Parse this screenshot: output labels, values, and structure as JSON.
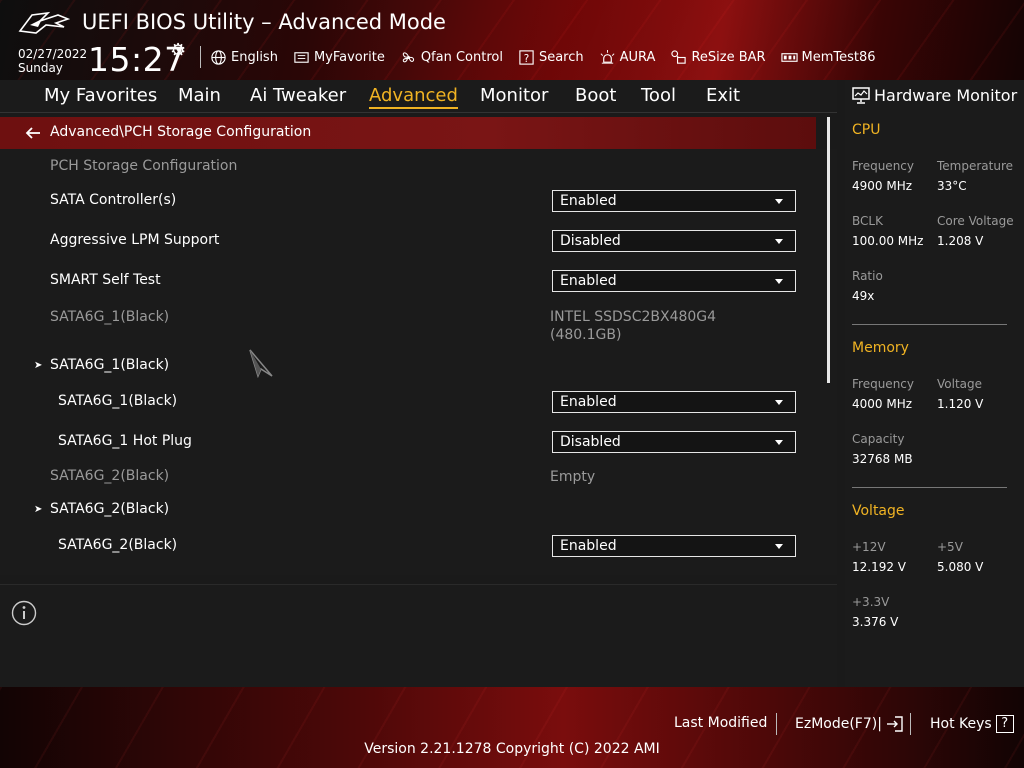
{
  "header": {
    "title": "UEFI BIOS Utility – Advanced Mode",
    "date": "02/27/2022",
    "day": "Sunday",
    "time": "15:27",
    "tools": [
      {
        "label": "English",
        "icon": "globe-icon"
      },
      {
        "label": "MyFavorite",
        "icon": "favorite-list-icon"
      },
      {
        "label": "Qfan Control",
        "icon": "fan-icon"
      },
      {
        "label": "Search",
        "icon": "search-help-icon"
      },
      {
        "label": "AURA",
        "icon": "aura-light-icon"
      },
      {
        "label": "ReSize BAR",
        "icon": "resize-bar-icon"
      },
      {
        "label": "MemTest86",
        "icon": "memtest-icon"
      }
    ]
  },
  "nav": {
    "tabs": [
      "My Favorites",
      "Main",
      "Ai Tweaker",
      "Advanced",
      "Monitor",
      "Boot",
      "Tool",
      "Exit"
    ],
    "active": "Advanced"
  },
  "breadcrumb": "Advanced\\PCH Storage Configuration",
  "settings": {
    "section_title": "PCH Storage Configuration",
    "sata_controller": {
      "label": "SATA Controller(s)",
      "value": "Enabled"
    },
    "aggressive_lpm": {
      "label": "Aggressive LPM Support",
      "value": "Disabled"
    },
    "smart_self_test": {
      "label": "SMART Self Test",
      "value": "Enabled"
    },
    "port1_info": {
      "label": "SATA6G_1(Black)",
      "value_line1": "INTEL SSDSC2BX480G4",
      "value_line2": "(480.1GB)"
    },
    "port1_group": {
      "label": "SATA6G_1(Black)"
    },
    "port1_enable": {
      "label": "SATA6G_1(Black)",
      "value": "Enabled"
    },
    "port1_hotplug": {
      "label": "SATA6G_1 Hot Plug",
      "value": "Disabled"
    },
    "port2_info": {
      "label": "SATA6G_2(Black)",
      "value": "Empty"
    },
    "port2_group": {
      "label": "SATA6G_2(Black)"
    },
    "port2_enable": {
      "label": "SATA6G_2(Black)",
      "value": "Enabled"
    }
  },
  "hardware_monitor": {
    "title": "Hardware Monitor",
    "cpu": {
      "title": "CPU",
      "frequency_label": "Frequency",
      "frequency": "4900 MHz",
      "temperature_label": "Temperature",
      "temperature": "33°C",
      "bclk_label": "BCLK",
      "bclk": "100.00 MHz",
      "core_voltage_label": "Core Voltage",
      "core_voltage": "1.208 V",
      "ratio_label": "Ratio",
      "ratio": "49x"
    },
    "memory": {
      "title": "Memory",
      "frequency_label": "Frequency",
      "frequency": "4000 MHz",
      "voltage_label": "Voltage",
      "voltage": "1.120 V",
      "capacity_label": "Capacity",
      "capacity": "32768 MB"
    },
    "voltage": {
      "title": "Voltage",
      "v12_label": "+12V",
      "v12": "12.192 V",
      "v5_label": "+5V",
      "v5": "5.080 V",
      "v33_label": "+3.3V",
      "v33": "3.376 V"
    }
  },
  "footer": {
    "last_modified": "Last Modified",
    "ezmode": "EzMode(F7)|",
    "hot_keys": "Hot Keys",
    "hot_keys_key": "?",
    "version": "Version 2.21.1278 Copyright (C) 2022 AMI"
  },
  "colors": {
    "accent": "#f0b323",
    "breadcrumb_bg": "#7a1515",
    "panel_bg": "#1b1b1b"
  }
}
